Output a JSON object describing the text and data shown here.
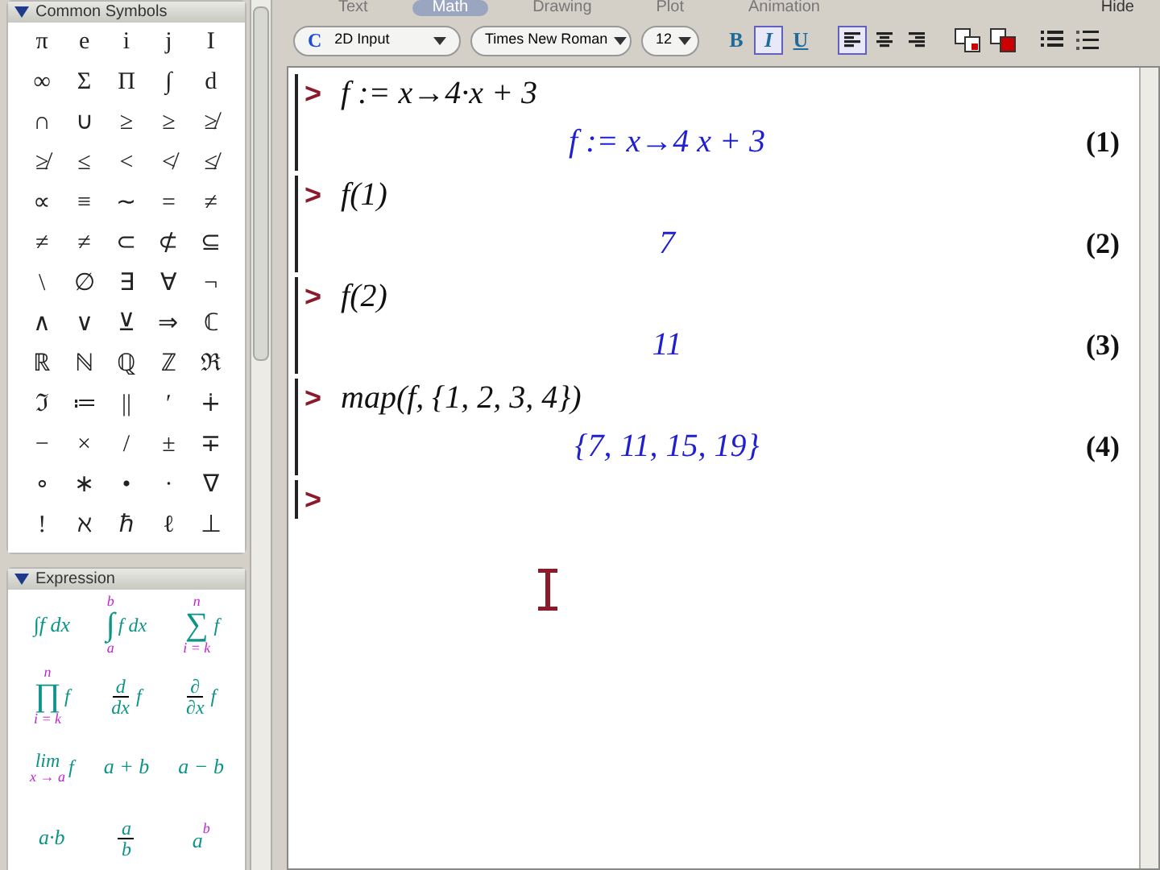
{
  "palettes": [
    {
      "title": "Common Symbols",
      "expanded": true,
      "symbols": [
        "π",
        "e",
        "i",
        "j",
        "I",
        "∞",
        "Σ",
        "Π",
        "∫",
        "d",
        "∩",
        "∪",
        "≥",
        "≥",
        "≱",
        "≱",
        "≤",
        "<",
        "≮",
        "≰",
        "∝",
        "≡",
        "∼",
        "=",
        "≠",
        "≠",
        "≠",
        "⊂",
        "⊄",
        "⊆",
        "\\",
        "∅",
        "∃",
        "∀",
        "¬",
        "∧",
        "∨",
        "⊻",
        "⇒",
        "ℂ",
        "ℝ",
        "ℕ",
        "ℚ",
        "ℤ",
        "ℜ",
        "ℑ",
        "≔",
        "||",
        "′",
        "∔",
        "−",
        "×",
        "/",
        "±",
        "∓",
        "∘",
        "∗",
        "•",
        "·",
        "∇",
        "!",
        "ℵ",
        "ℏ",
        "ℓ",
        "⊥"
      ]
    },
    {
      "title": "Expression",
      "expanded": true,
      "items": [
        {
          "kind": "plain",
          "text": "∫f dx"
        },
        {
          "kind": "bigop",
          "op": "∫",
          "sup": "b",
          "sub": "a",
          "body": "f dx"
        },
        {
          "kind": "bigop",
          "op": "∑",
          "sup": "n",
          "sub": "i = k",
          "body": "f"
        },
        {
          "kind": "bigop",
          "op": "∏",
          "sup": "n",
          "sub": "i = k",
          "body": "f"
        },
        {
          "kind": "frac",
          "num": "d",
          "den": "dx",
          "body": "f"
        },
        {
          "kind": "frac",
          "num": "∂",
          "den": "∂x",
          "body": "f"
        },
        {
          "kind": "limit",
          "op": "lim",
          "sub": "x → a",
          "body": "f"
        },
        {
          "kind": "plain",
          "text": "a + b"
        },
        {
          "kind": "plain",
          "text": "a − b"
        },
        {
          "kind": "plain",
          "text": "a·b"
        },
        {
          "kind": "frac",
          "num": "a",
          "den": "b"
        },
        {
          "kind": "power",
          "base": "a",
          "sup": "b"
        }
      ]
    }
  ],
  "mode_tabs": [
    {
      "label": "Text",
      "selected": false
    },
    {
      "label": "Math",
      "selected": true
    },
    {
      "label": "Drawing",
      "selected": false
    },
    {
      "label": "Plot",
      "selected": false
    },
    {
      "label": "Animation",
      "selected": false
    }
  ],
  "hide_label": "Hide",
  "toolbar": {
    "input_mode": "2D Input",
    "input_mode_icon": "C",
    "font": "Times New Roman",
    "size": "12",
    "styles": [
      {
        "label": "B",
        "selected": false
      },
      {
        "label": "I",
        "selected": true
      },
      {
        "label": "U",
        "selected": false
      }
    ],
    "alignments": [
      {
        "kind": "left",
        "selected": true
      },
      {
        "kind": "center",
        "selected": false
      },
      {
        "kind": "right",
        "selected": false
      }
    ]
  },
  "worksheet": [
    {
      "prompt": ">",
      "input": "f := x→4·x + 3",
      "output": "f := x→4 x + 3",
      "label": "(1)"
    },
    {
      "prompt": ">",
      "input": "f(1)",
      "output": "7",
      "label": "(2)"
    },
    {
      "prompt": ">",
      "input": "f(2)",
      "output": "11",
      "label": "(3)"
    },
    {
      "prompt": ">",
      "input": "map(f, {1, 2, 3, 4})",
      "output": "{7, 11, 15, 19}",
      "label": "(4)"
    },
    {
      "prompt": ">"
    }
  ]
}
